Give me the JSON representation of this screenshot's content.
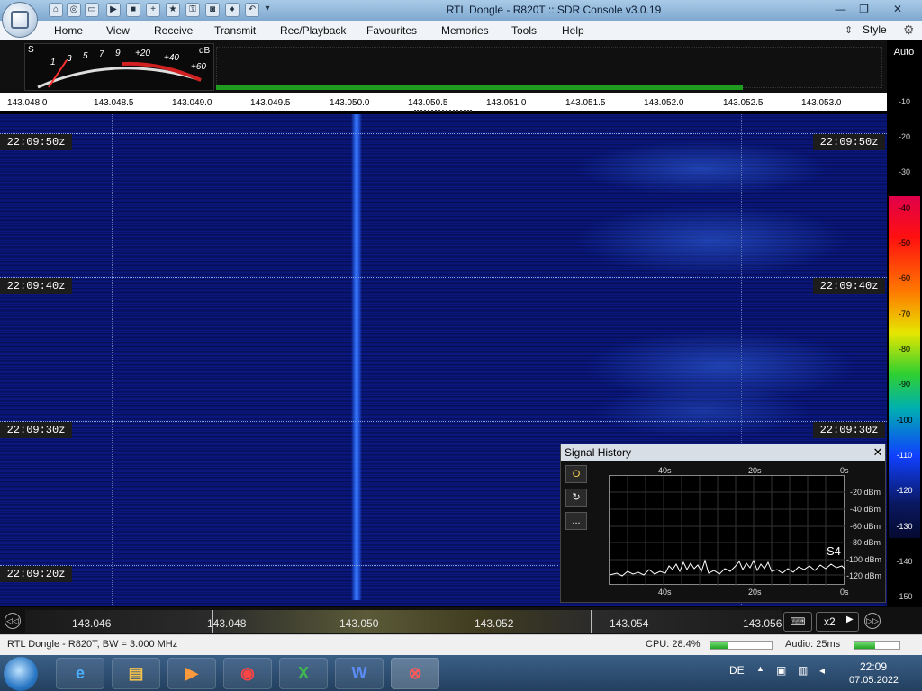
{
  "window": {
    "title": "RTL Dongle - R820T :: SDR Console v3.0.19",
    "minimize": "—",
    "maximize": "❐",
    "close": "✕"
  },
  "ribbon": {
    "tabs": [
      "Home",
      "View",
      "Receive",
      "Transmit",
      "Rec/Playback",
      "Favourites",
      "Memories",
      "Tools",
      "Help"
    ],
    "style_label": "Style"
  },
  "smeter": {
    "unit_s": "S",
    "unit_db": "dB",
    "scale": [
      "1",
      "3",
      "5",
      "7",
      "9",
      "+20",
      "+40",
      "+60"
    ]
  },
  "frequency_ruler": [
    "143.048.0",
    "143.048.5",
    "143.049.0",
    "143.049.5",
    "143.050.0",
    "143.050.5",
    "143.051.0",
    "143.051.5",
    "143.052.0",
    "143.052.5",
    "143.053.0"
  ],
  "timestamps": [
    "22:09:50z",
    "22:09:40z",
    "22:09:30z",
    "22:09:20z"
  ],
  "db_scale": {
    "auto": "Auto",
    "labels": [
      "-10",
      "-20",
      "-30",
      "-40",
      "-50",
      "-60",
      "-70",
      "-80",
      "-90",
      "-100",
      "-110",
      "-120",
      "-130",
      "-140",
      "-150"
    ]
  },
  "signal_history": {
    "title": "Signal History",
    "close": "✕",
    "time_top": [
      "40s",
      "20s",
      "0s"
    ],
    "time_bottom": [
      "40s",
      "20s",
      "0s"
    ],
    "levels": [
      "-20 dBm",
      "-40 dBm",
      "-60 dBm",
      "-80 dBm",
      "-100 dBm",
      "-120 dBm"
    ],
    "s_value": "S4",
    "buttons": [
      "O",
      "↻",
      "..."
    ]
  },
  "tuner": {
    "labels": [
      "143.046",
      "143.048",
      "143.050",
      "143.052",
      "143.054",
      "143.056"
    ],
    "multiplier": "x2"
  },
  "status": {
    "device": "RTL Dongle - R820T, BW = 3.000 MHz",
    "cpu": "CPU: 28.4%",
    "cpu_level": 0.28,
    "audio": "Audio: 25ms",
    "audio_level": 0.45
  },
  "taskbar": {
    "lang": "DE",
    "time": "22:09",
    "date": "07.05.2022",
    "apps": [
      "ie",
      "explorer",
      "media",
      "chrome",
      "excel",
      "word",
      "sdr-console"
    ]
  },
  "colors": {
    "waterfall": "#081575",
    "carrier": "#4a8cff",
    "accent_green": "#21a521"
  }
}
